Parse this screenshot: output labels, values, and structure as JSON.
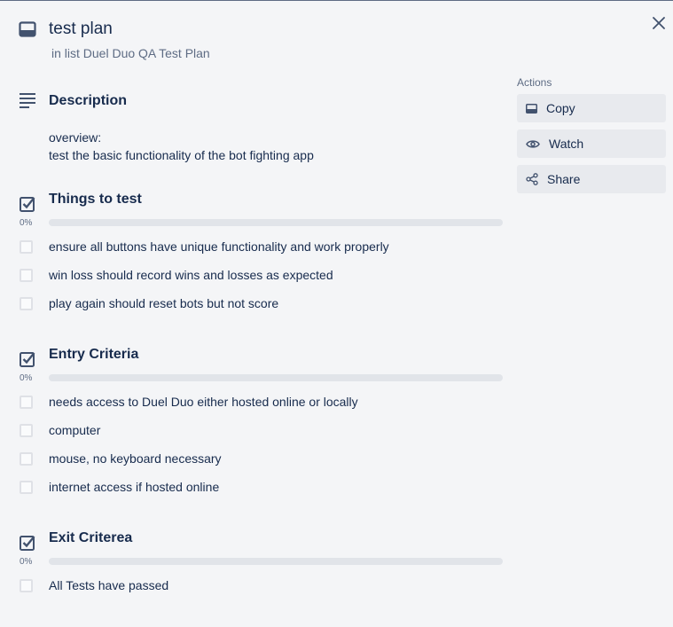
{
  "card": {
    "title": "test plan",
    "list_ref": "in list Duel Duo QA Test Plan"
  },
  "description": {
    "heading": "Description",
    "lines": [
      "overview:",
      "test the basic functionality of the bot fighting app"
    ]
  },
  "checklists": [
    {
      "title": "Things to test",
      "progress_label": "0%",
      "progress": 0,
      "items": [
        "ensure all buttons have unique functionality and work properly",
        "win loss should record wins and losses as expected",
        "play again should reset bots but not score"
      ]
    },
    {
      "title": "Entry Criteria",
      "progress_label": "0%",
      "progress": 0,
      "items": [
        "needs access to Duel Duo either hosted online or locally",
        "computer",
        "mouse, no keyboard necessary",
        "internet access if hosted online"
      ]
    },
    {
      "title": "Exit Criterea",
      "progress_label": "0%",
      "progress": 0,
      "items": [
        "All Tests have passed"
      ]
    }
  ],
  "sidebar": {
    "heading": "Actions",
    "buttons": [
      {
        "label": "Copy",
        "icon": "card-icon"
      },
      {
        "label": "Watch",
        "icon": "eye-icon"
      },
      {
        "label": "Share",
        "icon": "share-icon"
      }
    ]
  },
  "colors": {
    "background": "#f4f5f7",
    "text": "#172b4d",
    "subtle_text": "#5e6c84",
    "button_bg": "#e8eaee",
    "progress_track": "#e1e4e9"
  }
}
